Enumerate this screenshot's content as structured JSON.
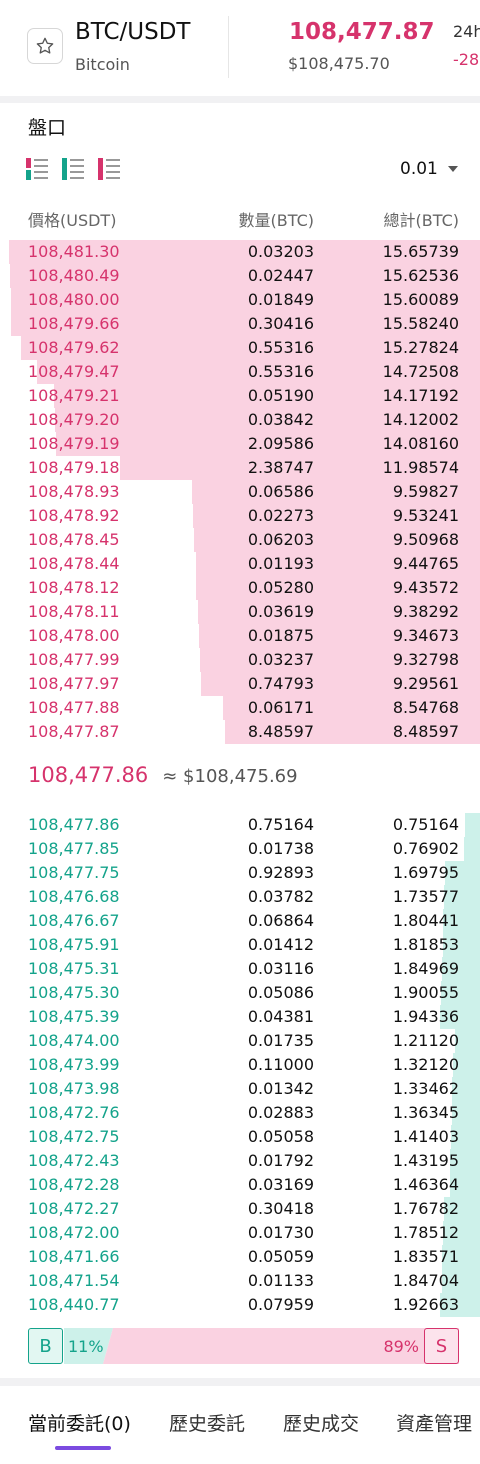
{
  "header": {
    "pair": "BTC/USDT",
    "name": "Bitcoin",
    "last_price": "108,477.87",
    "last_price_usd": "$108,475.70",
    "h24_label": "24h",
    "h24_change": "-28"
  },
  "orderbook": {
    "title": "盤口",
    "precision": "0.01",
    "columns": {
      "price": "價格(USDT)",
      "qty": "數量(BTC)",
      "total": "總計(BTC)"
    },
    "asks": [
      {
        "price": "108,481.30",
        "qty": "0.03203",
        "total": "15.65739",
        "depth": 0.981
      },
      {
        "price": "108,480.49",
        "qty": "0.02447",
        "total": "15.62536",
        "depth": 0.979
      },
      {
        "price": "108,480.00",
        "qty": "0.01849",
        "total": "15.60089",
        "depth": 0.977
      },
      {
        "price": "108,479.66",
        "qty": "0.30416",
        "total": "15.58240",
        "depth": 0.977
      },
      {
        "price": "108,479.62",
        "qty": "0.55316",
        "total": "15.27824",
        "depth": 0.957
      },
      {
        "price": "108,479.47",
        "qty": "0.55316",
        "total": "14.72508",
        "depth": 0.923
      },
      {
        "price": "108,479.21",
        "qty": "0.05190",
        "total": "14.17192",
        "depth": 0.888
      },
      {
        "price": "108,479.20",
        "qty": "0.03842",
        "total": "14.12002",
        "depth": 0.885
      },
      {
        "price": "108,479.19",
        "qty": "2.09586",
        "total": "14.08160",
        "depth": 0.883
      },
      {
        "price": "108,479.18",
        "qty": "2.38747",
        "total": "11.98574",
        "depth": 0.751
      },
      {
        "price": "108,478.93",
        "qty": "0.06586",
        "total": "9.59827",
        "depth": 0.601
      },
      {
        "price": "108,478.92",
        "qty": "0.02273",
        "total": "9.53241",
        "depth": 0.597
      },
      {
        "price": "108,478.45",
        "qty": "0.06203",
        "total": "9.50968",
        "depth": 0.596
      },
      {
        "price": "108,478.44",
        "qty": "0.01193",
        "total": "9.44765",
        "depth": 0.592
      },
      {
        "price": "108,478.12",
        "qty": "0.05280",
        "total": "9.43572",
        "depth": 0.591
      },
      {
        "price": "108,478.11",
        "qty": "0.03619",
        "total": "9.38292",
        "depth": 0.588
      },
      {
        "price": "108,478.00",
        "qty": "0.01875",
        "total": "9.34673",
        "depth": 0.586
      },
      {
        "price": "108,477.99",
        "qty": "0.03237",
        "total": "9.32798",
        "depth": 0.584
      },
      {
        "price": "108,477.97",
        "qty": "0.74793",
        "total": "9.29561",
        "depth": 0.582
      },
      {
        "price": "108,477.88",
        "qty": "0.06171",
        "total": "8.54768",
        "depth": 0.535
      },
      {
        "price": "108,477.87",
        "qty": "8.48597",
        "total": "8.48597",
        "depth": 0.531
      }
    ],
    "mid_price": "108,477.86",
    "mid_usd": "≈ $108,475.69",
    "bids": [
      {
        "price": "108,477.86",
        "qty": "0.75164",
        "total": "0.75164",
        "depth": 0.032
      },
      {
        "price": "108,477.85",
        "qty": "0.01738",
        "total": "0.76902",
        "depth": 0.033
      },
      {
        "price": "108,477.75",
        "qty": "0.92893",
        "total": "1.69795",
        "depth": 0.073
      },
      {
        "price": "108,476.68",
        "qty": "0.03782",
        "total": "1.73577",
        "depth": 0.075
      },
      {
        "price": "108,476.67",
        "qty": "0.06864",
        "total": "1.80441",
        "depth": 0.078
      },
      {
        "price": "108,475.91",
        "qty": "0.01412",
        "total": "1.81853",
        "depth": 0.078
      },
      {
        "price": "108,475.31",
        "qty": "0.03116",
        "total": "1.84969",
        "depth": 0.08
      },
      {
        "price": "108,475.30",
        "qty": "0.05086",
        "total": "1.90055",
        "depth": 0.082
      },
      {
        "price": "108,475.39",
        "qty": "0.04381",
        "total": "1.94336",
        "depth": 0.084
      },
      {
        "price": "108,474.00",
        "qty": "0.01735",
        "total": "1.21120",
        "depth": 0.052
      },
      {
        "price": "108,473.99",
        "qty": "0.11000",
        "total": "1.32120",
        "depth": 0.057
      },
      {
        "price": "108,473.98",
        "qty": "0.01342",
        "total": "1.33462",
        "depth": 0.058
      },
      {
        "price": "108,472.76",
        "qty": "0.02883",
        "total": "1.36345",
        "depth": 0.059
      },
      {
        "price": "108,472.75",
        "qty": "0.05058",
        "total": "1.41403",
        "depth": 0.061
      },
      {
        "price": "108,472.43",
        "qty": "0.01792",
        "total": "1.43195",
        "depth": 0.062
      },
      {
        "price": "108,472.28",
        "qty": "0.03169",
        "total": "1.46364",
        "depth": 0.063
      },
      {
        "price": "108,472.27",
        "qty": "0.30418",
        "total": "1.76782",
        "depth": 0.076
      },
      {
        "price": "108,472.00",
        "qty": "0.01730",
        "total": "1.78512",
        "depth": 0.077
      },
      {
        "price": "108,471.66",
        "qty": "0.05059",
        "total": "1.83571",
        "depth": 0.079
      },
      {
        "price": "108,471.54",
        "qty": "0.01133",
        "total": "1.84704",
        "depth": 0.08
      },
      {
        "price": "108,440.77",
        "qty": "0.07959",
        "total": "1.92663",
        "depth": 0.083
      }
    ],
    "ratio": {
      "buy_label": "B",
      "buy_pct": "11%",
      "sell_pct": "89%",
      "sell_label": "S",
      "buy_fraction": 0.11
    }
  },
  "tabs": [
    {
      "label": "當前委託(0)",
      "active": true
    },
    {
      "label": "歷史委託",
      "active": false
    },
    {
      "label": "歷史成交",
      "active": false
    },
    {
      "label": "資產管理",
      "active": false
    }
  ],
  "colors": {
    "ask": "#d6336c",
    "bid": "#14a38b",
    "accent": "#7b4be0"
  }
}
